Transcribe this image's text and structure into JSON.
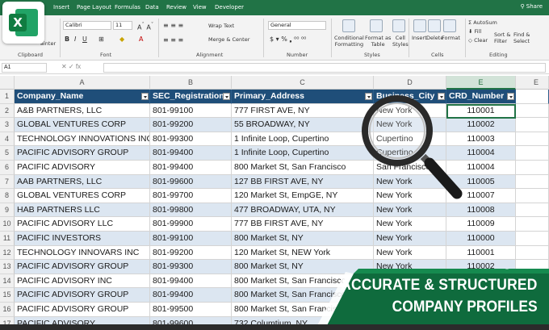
{
  "ribbon": {
    "tabs": [
      "Insert",
      "Page Layout",
      "Formulas",
      "Data",
      "Review",
      "View",
      "Developer"
    ],
    "share_label": "Share",
    "clipboard": {
      "painter": "ainter",
      "group": "Clipboard"
    },
    "font": {
      "name": "Calibri",
      "size": "11",
      "group": "Font"
    },
    "alignment": {
      "wrap": "Wrap Text",
      "merge": "Merge & Center",
      "group": "Alignment"
    },
    "number": {
      "format": "General",
      "group": "Number"
    },
    "styles": {
      "conditional": "Conditional\nFormatting",
      "format_table": "Format as\nTable",
      "cell_styles": "Cell\nStyles",
      "group": "Styles"
    },
    "cells": {
      "insert": "Insert",
      "delete": "Delete",
      "format": "Format",
      "group": "Cells"
    },
    "editing": {
      "autosum": "AutoSum",
      "fill": "Fill",
      "clear": "Clear",
      "sort": "Sort &\nFilter",
      "find": "Find &\nSelect",
      "group": "Editing"
    }
  },
  "formula_bar": {
    "name_box": "A1",
    "fx": "✕  ✓  fx"
  },
  "columns": [
    "A",
    "B",
    "C",
    "D",
    "E"
  ],
  "extra_column": "E",
  "sheet": {
    "headers": [
      "Company_Name",
      "SEC_Registration_",
      "Primary_Address",
      "Business_City",
      "CRD_Number"
    ],
    "rows": [
      [
        "A&B PARTNERS, LLC",
        "801-99100",
        "777 FIRST AVE, NY",
        "New York",
        "110001"
      ],
      [
        "GLOBAL VENTURES CORP",
        "801-99200",
        "55 BROADWAY, NY",
        "New York",
        "110002"
      ],
      [
        "TECHNOLOGY INNOVATIONS INC",
        "801-99300",
        "1 Infinite Loop, Cupertino",
        "Cupertino",
        "110003"
      ],
      [
        "PACIFIC ADVISORY GROUP",
        "801-99400",
        "1 Infinite Loop, Cupertino",
        "Cupertino",
        "110004"
      ],
      [
        "PACIFIC ADVISORY",
        "801-99400",
        "800 Market St, San Francisco",
        "San Francisco",
        "110004"
      ],
      [
        "AAB PARTNERS, LLC",
        "801-99600",
        "127 BB FIRST AVE, NY",
        "New York",
        "110005"
      ],
      [
        "GLOBAL VENTURES CORP",
        "801-99700",
        "120 Market St, EmpGE, NY",
        "New York",
        "110007"
      ],
      [
        "HAB PARTNERS LLC",
        "801-99800",
        "477 BROADWAY,  UTA, NY",
        "New York",
        "110008"
      ],
      [
        "PACIFIC ADVISORY LLC",
        "801-99900",
        "777 BB FIRST AVE, NY",
        "New York",
        "110009"
      ],
      [
        "PACIFIC INVESTORS",
        "801-99100",
        "800 Market St, NY",
        "New York",
        "110000"
      ],
      [
        "TECHNOLOGY INNOVARS INC",
        "801-99200",
        "120 Market St, NEW York",
        "New York",
        "110001"
      ],
      [
        "PACIFIC ADVISORY GROUP",
        "801-99300",
        "800 Market St, NY",
        "New York",
        "110002"
      ],
      [
        "PACIFIC ADVISORY INC",
        "801-99400",
        "800 Market St, San Francisco",
        "",
        ""
      ],
      [
        "PACIFIC ADVISORY GROUP",
        "801-99400",
        "800 Market St, San Francisco",
        "",
        ""
      ],
      [
        "PACIFIC ADVISORY GROUP",
        "801-99500",
        "800 Market St, San Francisco",
        "",
        ""
      ],
      [
        "PACIFIC ADVISORY",
        "801-99600",
        "732 Columtium, NY",
        "",
        ""
      ]
    ]
  },
  "banner": {
    "line1": "ACCURATE & STRUCTURED",
    "line2": "COMPANY PROFILES"
  },
  "colors": {
    "excel_green": "#217346",
    "header_blue": "#1f4e79",
    "band_blue": "#dce6f1",
    "banner_green": "#0f6b3d"
  }
}
